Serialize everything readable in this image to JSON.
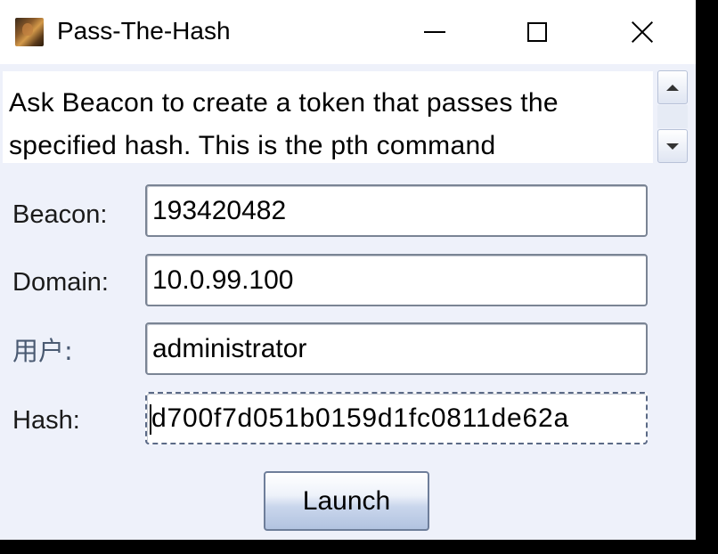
{
  "window": {
    "title": "Pass-The-Hash",
    "app_icon": "cobalt-strike-icon",
    "controls": {
      "minimize": "minimize-icon",
      "maximize": "maximize-icon",
      "close": "close-icon"
    }
  },
  "description": {
    "text": "Ask Beacon to create a token that passes the specified hash. This is the pth command"
  },
  "form": {
    "beacon": {
      "label": "Beacon:",
      "value": "193420482"
    },
    "domain": {
      "label": "Domain:",
      "value": "10.0.99.100"
    },
    "user": {
      "label": "用户:",
      "value": "administrator"
    },
    "hash": {
      "label": "Hash:",
      "value": "d700f7d051b0159d1fc0811de62a"
    }
  },
  "actions": {
    "launch_label": "Launch"
  },
  "colors": {
    "window_bg": "#eef1fa",
    "titlebar_bg": "#ffffff",
    "button_gradient_bottom": "#b2c3e0"
  }
}
